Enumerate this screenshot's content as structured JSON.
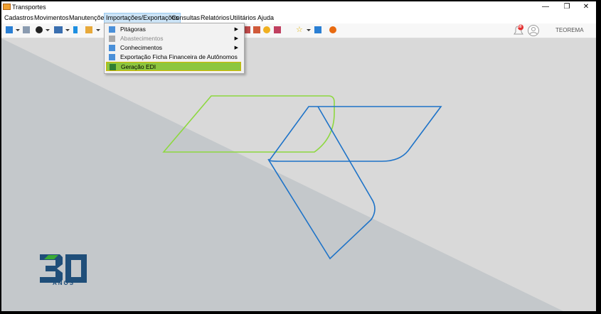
{
  "window": {
    "title": "Transportes"
  },
  "menubar": {
    "items": [
      {
        "label": "Cadastros"
      },
      {
        "label": "Movimentos"
      },
      {
        "label": "Manutenções"
      },
      {
        "label": "Importações/Exportações"
      },
      {
        "label": "Consultas"
      },
      {
        "label": "Relatórios"
      },
      {
        "label": "Utilitários"
      },
      {
        "label": "Ajuda"
      }
    ],
    "active_index": 3
  },
  "dropdown": {
    "items": [
      {
        "label": "Pitágoras",
        "submenu": true,
        "enabled": true
      },
      {
        "label": "Abastecimentos",
        "submenu": true,
        "enabled": false
      },
      {
        "label": "Conhecimentos",
        "submenu": true,
        "enabled": true
      },
      {
        "label": "Exportação Ficha Financeira de Autônomos",
        "submenu": false,
        "enabled": true
      },
      {
        "label": "Geração EDI",
        "submenu": false,
        "enabled": true,
        "highlighted": true
      }
    ]
  },
  "toolbar": {
    "user": "TEOREMA",
    "notification_badge": "00"
  },
  "logo": {
    "number": "30",
    "text": "ANOS"
  },
  "colors": {
    "highlight": "#8dc63f",
    "brand_blue": "#1f4e79",
    "line_green": "#8dd83f",
    "line_blue": "#1e73c8"
  }
}
